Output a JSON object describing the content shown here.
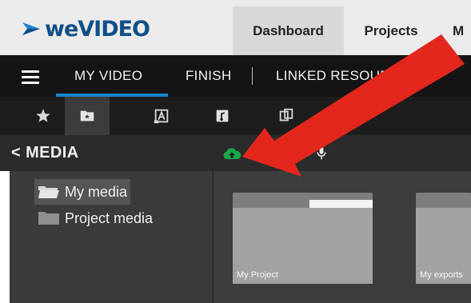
{
  "header": {
    "logo_text": "weVIDEO",
    "nav": [
      "Dashboard",
      "Projects",
      "M"
    ]
  },
  "editor_tabs": {
    "my_video": "MY VIDEO",
    "finish": "FINISH",
    "linked_resources": "LINKED RESOURCES"
  },
  "toolbar_icons": [
    "star-icon",
    "media-folder-icon",
    "text-icon",
    "music-icon",
    "transitions-icon",
    "frames-icon"
  ],
  "media": {
    "back_glyph": "<",
    "title": "MEDIA",
    "tools": [
      "upload-icon",
      "record-icon",
      "microphone-icon"
    ]
  },
  "tree": {
    "items": [
      "My media",
      "Project media"
    ]
  },
  "grid": {
    "folders": [
      "My Project",
      "My exports"
    ]
  },
  "colors": {
    "accent_blue": "#1b83cf",
    "upload_green": "#1aa54a",
    "record_red": "#e31e24",
    "arrow_red": "#e3271d",
    "logo_navy": "#0f4f86"
  }
}
